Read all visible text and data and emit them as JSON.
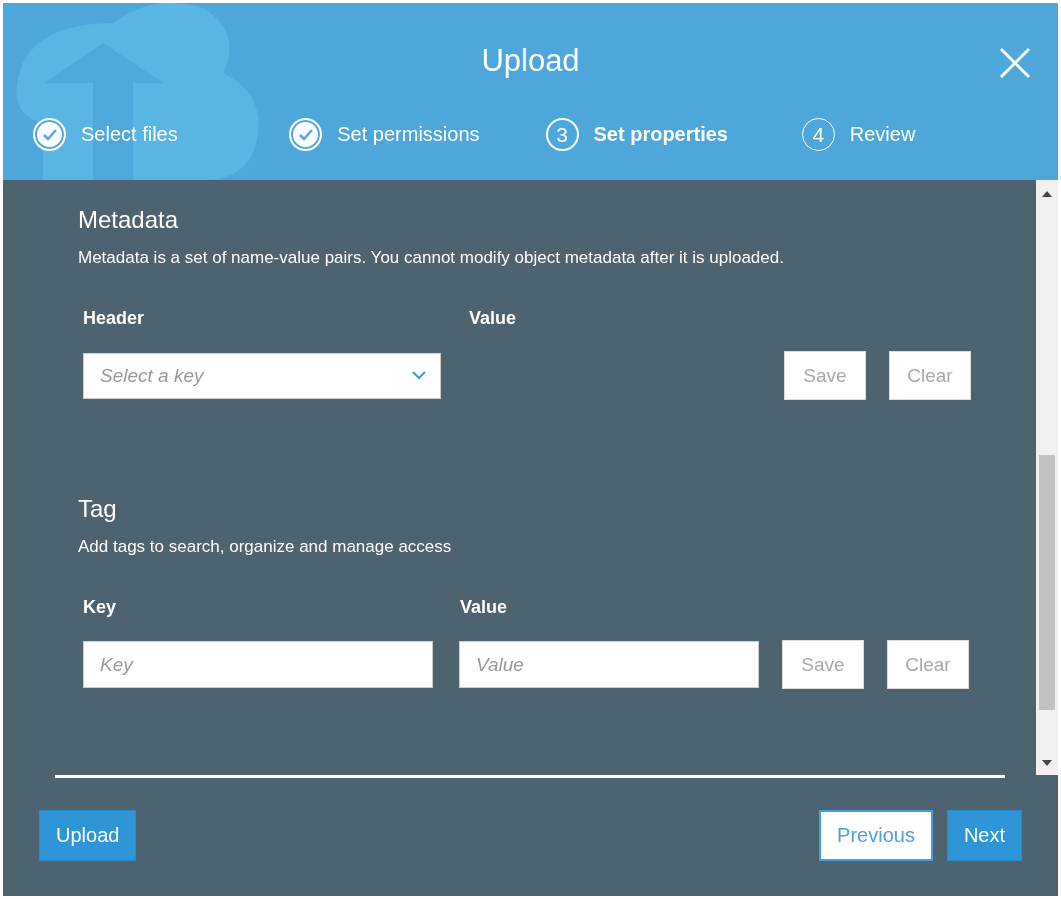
{
  "dialog": {
    "title": "Upload"
  },
  "steps": [
    {
      "label": "Select files",
      "completed": true,
      "selected": false
    },
    {
      "label": "Set permissions",
      "completed": true,
      "selected": false
    },
    {
      "label": "Set properties",
      "completed": false,
      "selected": true,
      "number": "3"
    },
    {
      "label": "Review",
      "completed": false,
      "selected": false,
      "number": "4"
    }
  ],
  "metadata": {
    "title": "Metadata",
    "description": "Metadata is a set of name-value pairs. You cannot modify object metadata after it is uploaded.",
    "columns": [
      "Header",
      "Value"
    ],
    "key_select": {
      "placeholder": "Select a key"
    },
    "buttons": [
      {
        "label": "Save",
        "disabled": true
      },
      {
        "label": "Clear",
        "disabled": true
      }
    ]
  },
  "tag": {
    "title": "Tag",
    "description": "Add tags to search, organize and manage access",
    "columns": [
      "Key",
      "Value"
    ],
    "key_field": {
      "placeholder": "Key"
    },
    "value_field": {
      "placeholder": "Value"
    },
    "buttons": [
      {
        "label": "Save",
        "disabled": true
      },
      {
        "label": "Clear",
        "disabled": true
      }
    ]
  },
  "footer": {
    "upload": "Upload",
    "previous": "Previous",
    "next": "Next"
  }
}
